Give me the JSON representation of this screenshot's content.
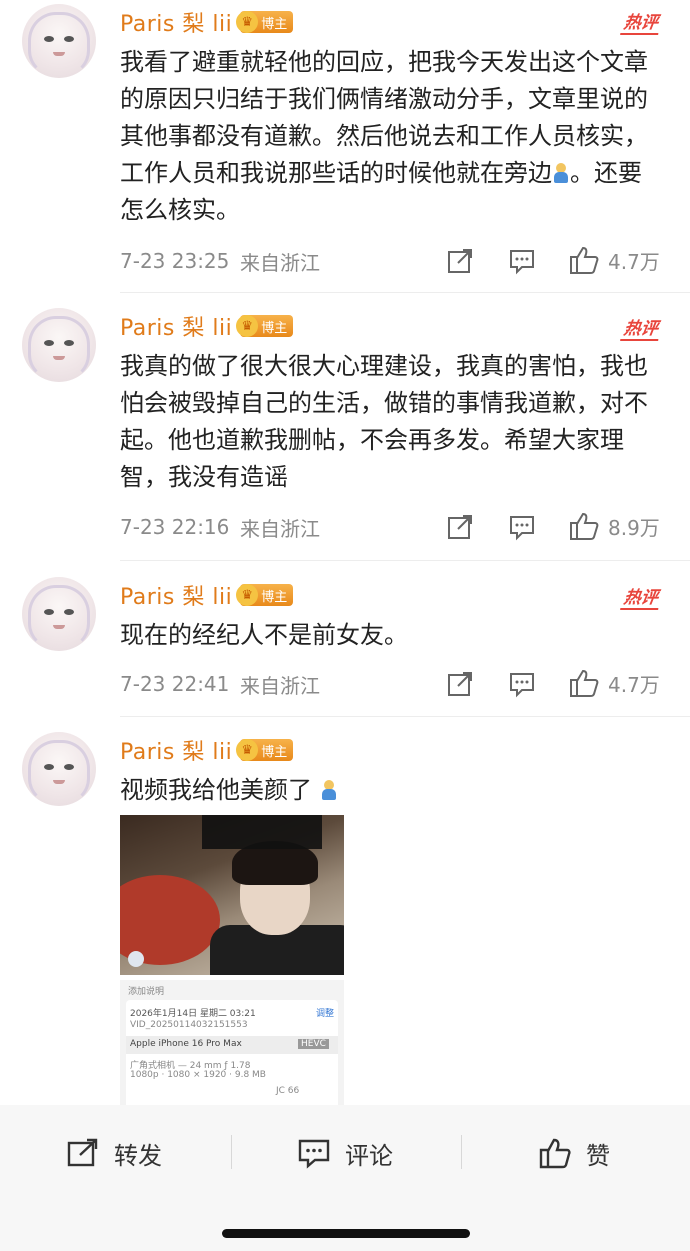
{
  "comments": [
    {
      "username": "Paris 梨 lii",
      "badge": "博主",
      "hot": "热评",
      "text": "我看了避重就轻他的回应，把我今天发出这个文章的原因只归结于我们俩情绪激动分手，文章里说的其他事都没有道歉。然后他说去和工作人员核实，工作人员和我说那些话的时候他就在旁边",
      "text_after_emoji": "。还要怎么核实。",
      "time": "7-23 23:25",
      "location": "来自浙江",
      "likes": "4.7万"
    },
    {
      "username": "Paris 梨 lii",
      "badge": "博主",
      "hot": "热评",
      "text": "我真的做了很大很大心理建设，我真的害怕，我也怕会被毁掉自己的生活，做错的事情我道歉，对不起。他也道歉我删帖，不会再多发。希望大家理智，我没有造谣",
      "time": "7-23 22:16",
      "location": "来自浙江",
      "likes": "8.9万"
    },
    {
      "username": "Paris 梨 lii",
      "badge": "博主",
      "hot": "热评",
      "text": "现在的经纪人不是前女友。",
      "time": "7-23 22:41",
      "location": "来自浙江",
      "likes": "4.7万"
    },
    {
      "username": "Paris 梨 lii",
      "badge": "博主",
      "text": "视频我给他美颜了"
    }
  ],
  "image_details": {
    "add_caption": "添加说明",
    "date": "2026年1月14日 星期二 03:21",
    "adjust": "调整",
    "filename": "VID_20250114032151553",
    "device": "Apple iPhone 16 Pro Max",
    "hevc": "HEVC",
    "lens": "广角式相机 — 24 mm ƒ 1.78",
    "specs": "1080p · 1080 × 1920 · 9.8 MB",
    "code": "JC 66"
  },
  "bottom_bar": {
    "repost": "转发",
    "comment": "评论",
    "like": "赞"
  }
}
